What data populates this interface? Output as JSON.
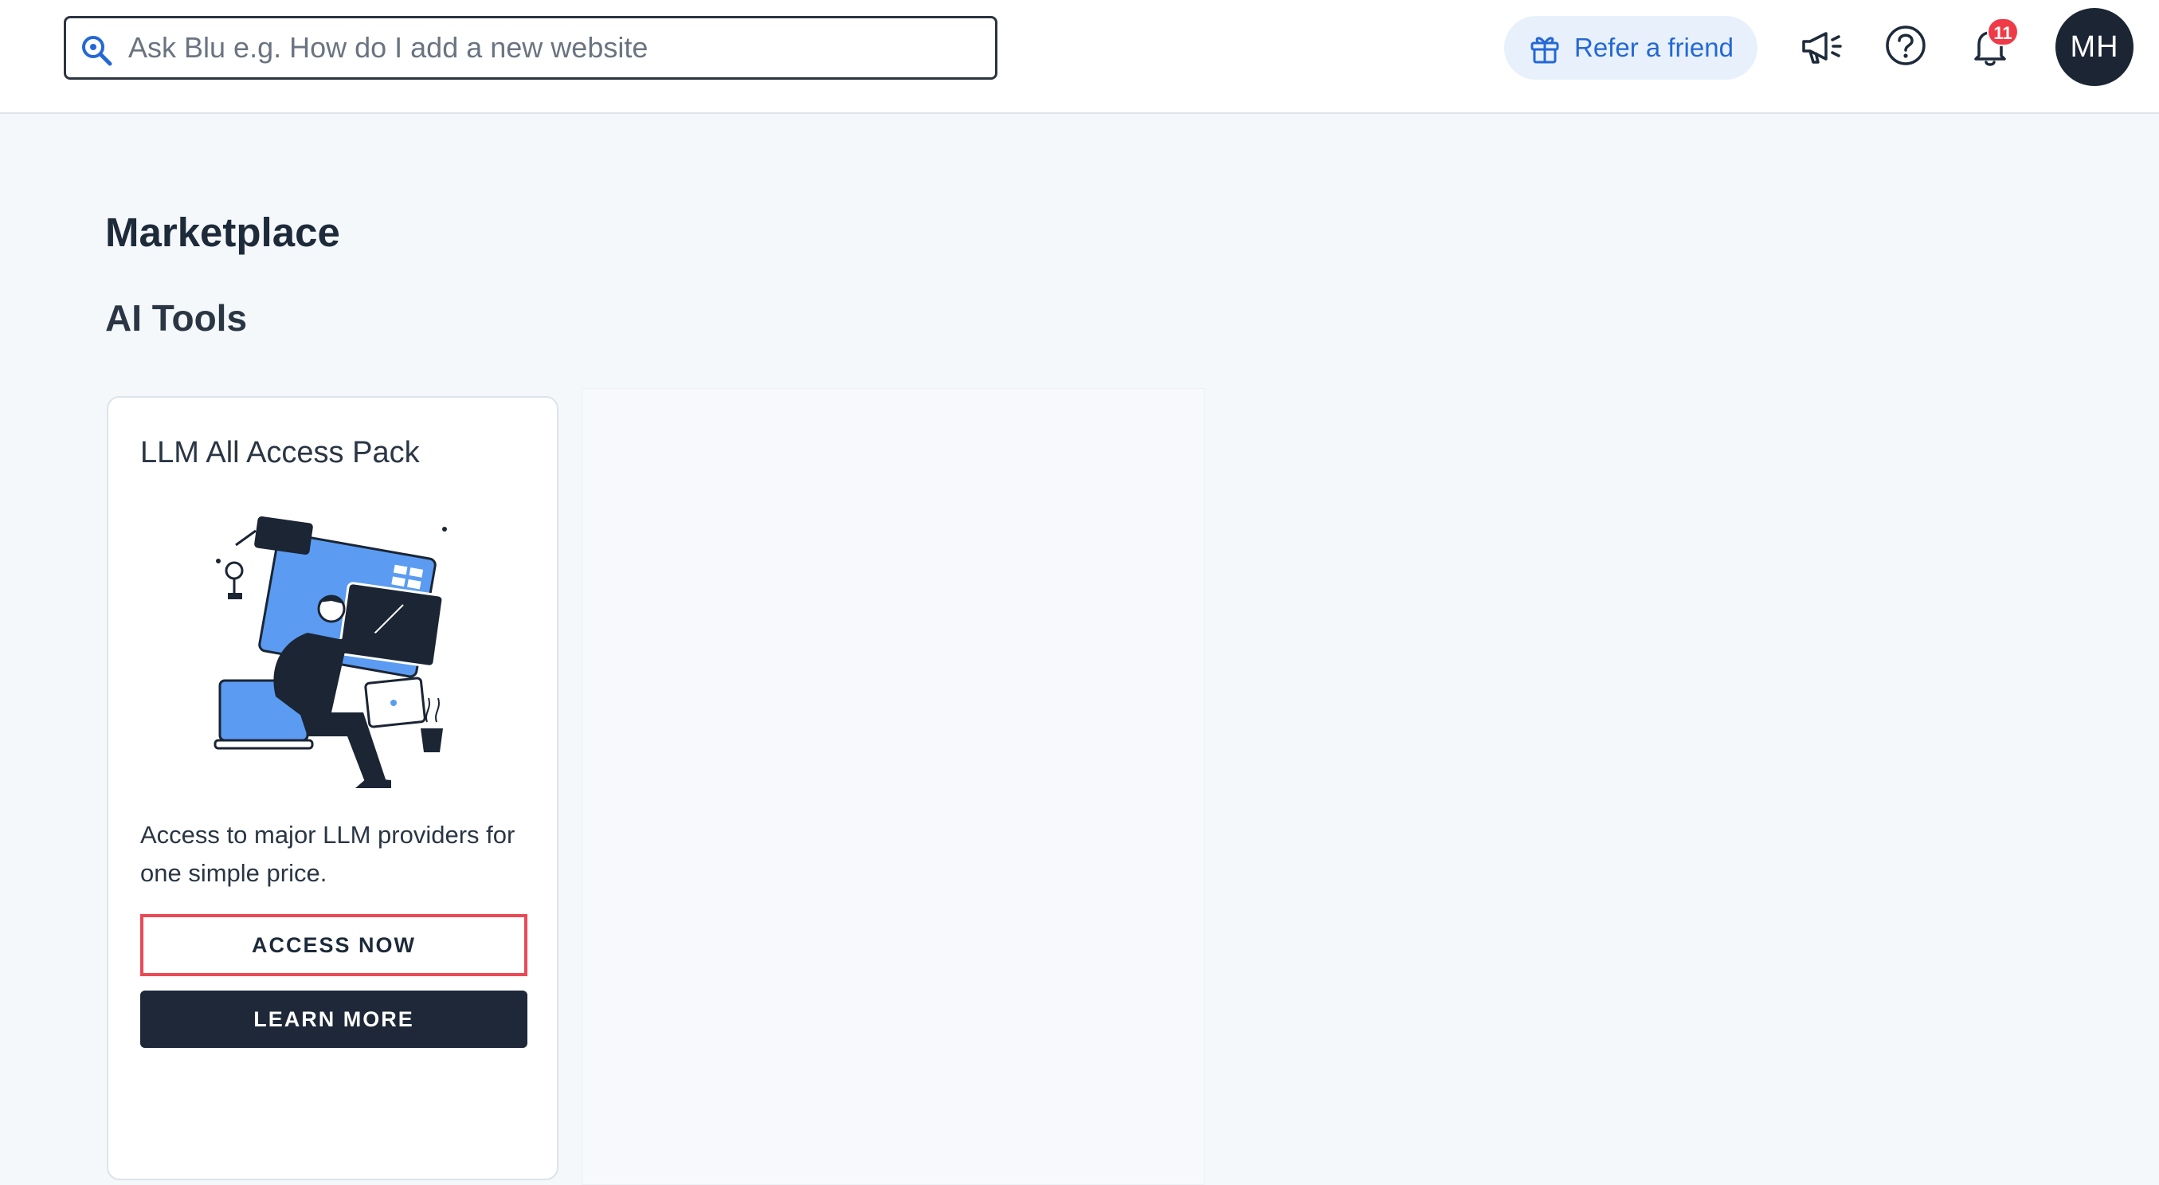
{
  "header": {
    "search": {
      "placeholder": "Ask Blu e.g. How do I add a new website",
      "value": ""
    },
    "refer_label": "Refer a friend",
    "notification_count": "11",
    "avatar_initials": "MH"
  },
  "main": {
    "page_title": "Marketplace",
    "section_title": "AI Tools",
    "cards": [
      {
        "title": "LLM All Access Pack",
        "description": "Access to major LLM providers for one simple price.",
        "primary_button": "ACCESS NOW",
        "secondary_button": "LEARN MORE"
      }
    ]
  },
  "colors": {
    "accent_blue": "#2468d6",
    "dark_navy": "#1e2838",
    "highlight_red": "#ea4a55",
    "badge_red": "#ef3b47",
    "illustration_blue": "#5b9cf2"
  },
  "icons": {
    "search": "search-icon",
    "refer": "gift-icon",
    "announce": "megaphone-icon",
    "help": "help-circle-icon",
    "notifications": "bell-icon"
  }
}
